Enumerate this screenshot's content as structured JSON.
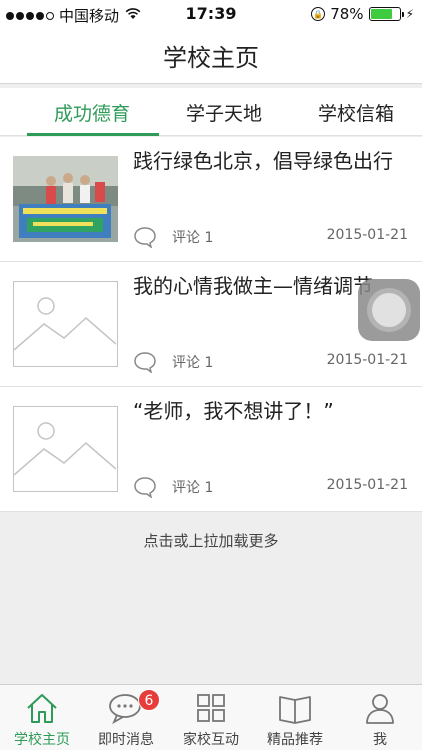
{
  "status_bar": {
    "carrier": "中国移动",
    "time": "17:39",
    "battery": "78%",
    "battery_level": 0.78
  },
  "nav": {
    "title": "学校主页"
  },
  "tabs": [
    {
      "label": "成功德育",
      "active": true
    },
    {
      "label": "学子天地",
      "active": false
    },
    {
      "label": "学校信箱",
      "active": false
    }
  ],
  "articles": [
    {
      "title": "践行绿色北京，倡导绿色出行",
      "comment": "评论 1",
      "date": "2015-01-21",
      "has_photo": true
    },
    {
      "title": "我的心情我做主—情绪调节",
      "comment": "评论 1",
      "date": "2015-01-21",
      "has_photo": false
    },
    {
      "title": "“老师，我不想讲了！”",
      "comment": "评论 1",
      "date": "2015-01-21",
      "has_photo": false
    }
  ],
  "load_more": "点击或上拉加载更多",
  "tabbar": [
    {
      "label": "学校主页",
      "icon": "home-icon",
      "active": true
    },
    {
      "label": "即时消息",
      "icon": "chat-icon",
      "badge": "6"
    },
    {
      "label": "家校互动",
      "icon": "grid-icon"
    },
    {
      "label": "精品推荐",
      "icon": "book-icon"
    },
    {
      "label": "我",
      "icon": "person-icon"
    }
  ],
  "colors": {
    "accent": "#2e9b58",
    "badge": "#e73c3c",
    "battery": "#3fcb3f"
  }
}
